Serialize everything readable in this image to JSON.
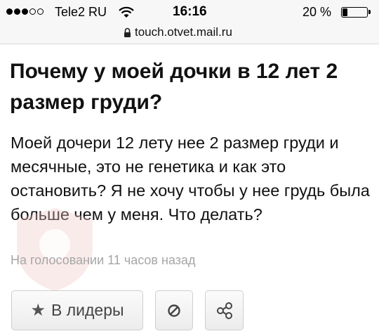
{
  "status_bar": {
    "carrier": "Tele2 RU",
    "time": "16:16",
    "battery_percent_label": "20 %",
    "battery_level": 0.2,
    "signal_strength": 3,
    "signal_max": 5
  },
  "browser": {
    "url": "touch.otvet.mail.ru"
  },
  "question": {
    "title": "Почему у моей дочки в 12 лет 2 размер груди?",
    "body": "Моей дочери 12 лету нее 2 размер груди и месячные, это не генетика и как это остановить? Я не хочу чтобы у нее грудь была больше чем у меня. Что делать?",
    "meta": "На голосовании 11 часов назад"
  },
  "actions": {
    "leaders_label": "В лидеры",
    "leaders_icon": "star-icon",
    "report_icon": "block-icon",
    "share_icon": "share-icon"
  },
  "colors": {
    "text": "#111111",
    "meta_text": "#a6a6a6",
    "button_border": "#cfcfcf",
    "bar_background": "#f7f7f7"
  }
}
